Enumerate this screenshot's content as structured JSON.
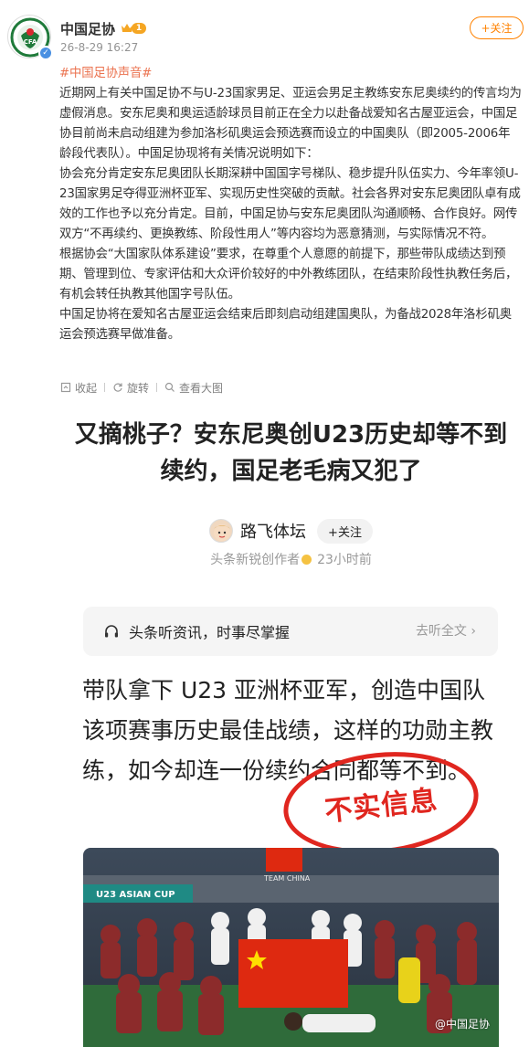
{
  "header": {
    "username": "中国足协",
    "vip_level": "1",
    "post_time": "26-8-29 16:27",
    "follow_label": "+关注",
    "avatar_text": "CFA"
  },
  "post": {
    "hashtag": "#中国足协声音#",
    "paragraphs": [
      "近期网上有关中国足协不与U-23国家男足、亚运会男足主教练安东尼奥续约的传言均为虚假消息。安东尼奥和奥运适龄球员目前正在全力以赴备战爱知名古屋亚运会，中国足协目前尚未启动组建为参加洛杉矶奥运会预选赛而设立的中国奥队（即2005-2006年龄段代表队）。中国足协现将有关情况说明如下：",
      "协会充分肯定安东尼奥团队长期深耕中国国字号梯队、稳步提升队伍实力、今年率领U-23国家男足夺得亚洲杯亚军、实现历史性突破的贡献。社会各界对安东尼奥团队卓有成效的工作也予以充分肯定。目前，中国足协与安东尼奥团队沟通顺畅、合作良好。网传双方“不再续约、更换教练、阶段性用人”等内容均为恶意猜测，与实际情况不符。",
      "根据协会“大国家队体系建设”要求，在尊重个人意愿的前提下，那些带队成绩达到预期、管理到位、专家评估和大众评价较好的中外教练团队，在结束阶段性执教任务后，有机会转任执教其他国字号队伍。",
      "中国足协将在爱知名古屋亚运会结束后即刻启动组建国奥队，为备战2028年洛杉矶奥运会预选赛早做准备。"
    ]
  },
  "actions": {
    "collapse": "收起",
    "rotate": "旋转",
    "view_large": "查看大图"
  },
  "article": {
    "title": "又摘桃子？安东尼奥创U23历史却等不到续约，国足老毛病又犯了",
    "author": "路飞体坛",
    "author_follow": "+关注",
    "author_desc": "头条新锐创作者",
    "author_time": "23小时前",
    "listen_text": "头条听资讯，时事尽掌握",
    "listen_link": "去听全文 ›",
    "body": "带队拿下 U23 亚洲杯亚军，创造中国队该项赛事历史最佳战绩，这样的功勋主教练，如今却连一份续约合同都等不到。",
    "stamp": "不实信息",
    "photo_banner": "U23 ASIAN CUP",
    "photo_tag": "TEAM CHINA"
  },
  "watermark": "@中国足协",
  "colors": {
    "accent": "#ff8200",
    "hashtag": "#eb7350",
    "stamp": "#e0261f"
  }
}
